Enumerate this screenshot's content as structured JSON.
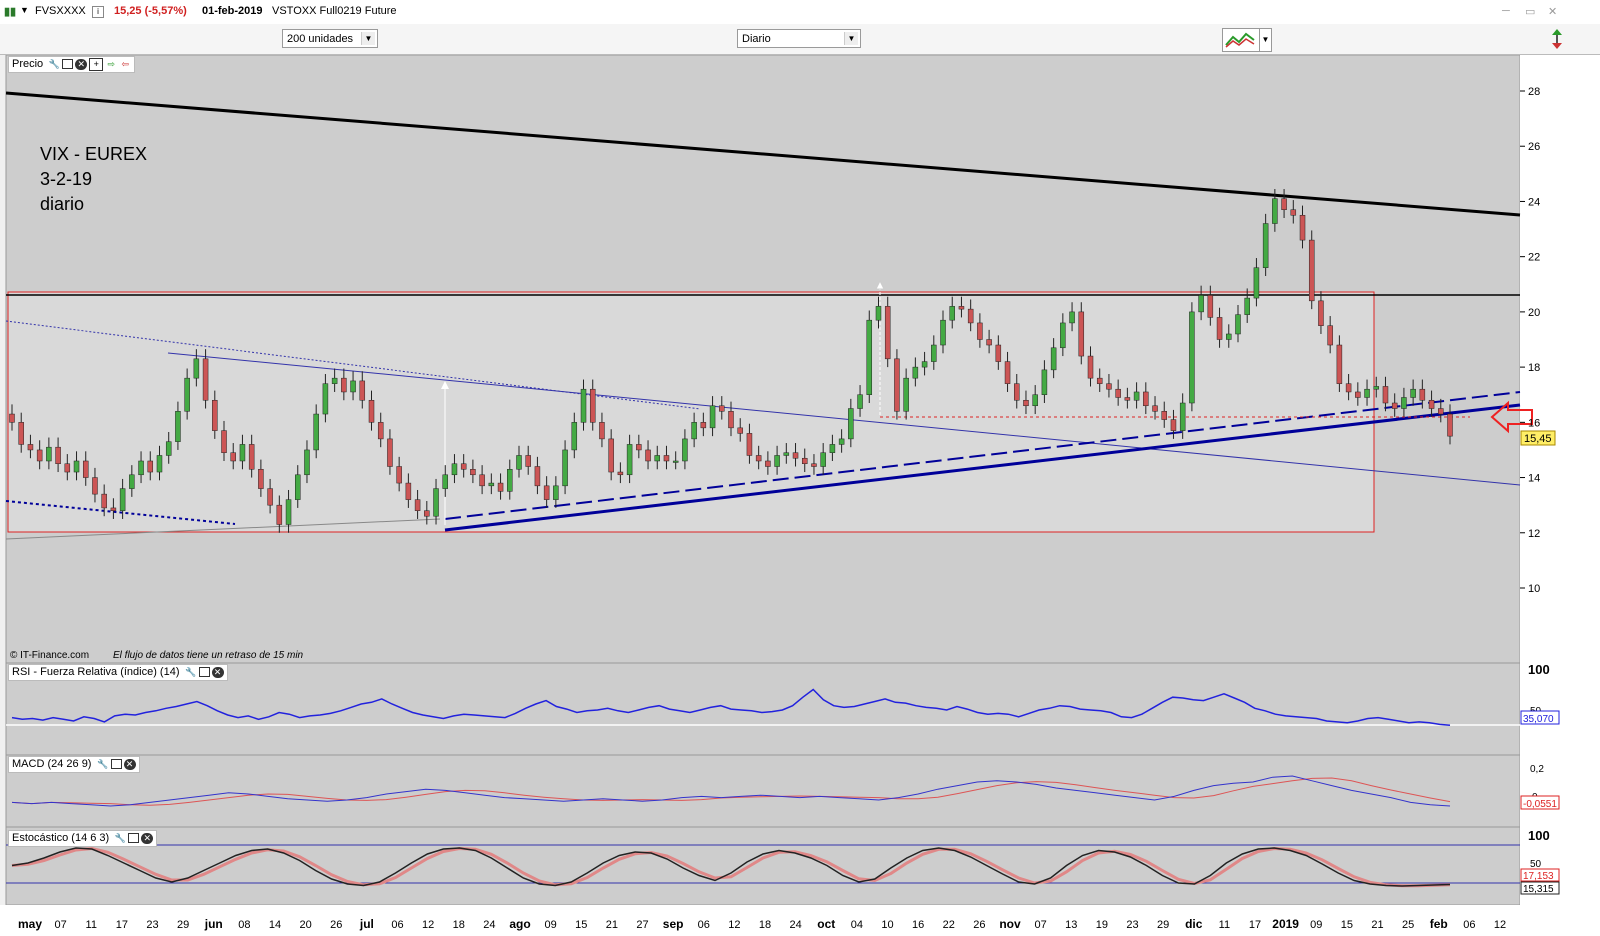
{
  "window": {
    "symbol": "FVSXXXX",
    "change": "15,25 (-5,57%)",
    "date": "01-feb-2019",
    "description": "VSTOXX Full0219 Future"
  },
  "toolbar": {
    "units_select": "200 unidades",
    "period_select": "Diario"
  },
  "price_panel": {
    "title": "Precio",
    "annotation_lines": [
      "VIX - EUREX",
      "3-2-19",
      "diario"
    ],
    "footer_source": "© IT-Finance.com",
    "footer_note": "El flujo de datos tiene un retraso de 15 min",
    "y_ticks": [
      "28",
      "26",
      "24",
      "22",
      "20",
      "18",
      "16",
      "14",
      "12",
      "10"
    ],
    "last_price_label": "15,45"
  },
  "rsi_panel": {
    "title": "RSI - Fuerza Relativa (índice) (14)",
    "y_ticks": [
      "100",
      "50"
    ],
    "value_label": "35,070"
  },
  "macd_panel": {
    "title": "MACD (24 26 9)",
    "y_ticks": [
      "0,2",
      "0"
    ],
    "value_label": "-0,0551"
  },
  "stoch_panel": {
    "title": "Estocástico (14 6 3)",
    "y_ticks": [
      "100",
      "50"
    ],
    "value_label_1": "17,153",
    "value_label_2": "15,315"
  },
  "x_axis": {
    "labels": [
      {
        "t": "may",
        "bold": true
      },
      {
        "t": "07"
      },
      {
        "t": "11"
      },
      {
        "t": "17"
      },
      {
        "t": "23"
      },
      {
        "t": "29"
      },
      {
        "t": "jun",
        "bold": true
      },
      {
        "t": "08"
      },
      {
        "t": "14"
      },
      {
        "t": "20"
      },
      {
        "t": "26"
      },
      {
        "t": "jul",
        "bold": true
      },
      {
        "t": "06"
      },
      {
        "t": "12"
      },
      {
        "t": "18"
      },
      {
        "t": "24"
      },
      {
        "t": "ago",
        "bold": true
      },
      {
        "t": "09"
      },
      {
        "t": "15"
      },
      {
        "t": "21"
      },
      {
        "t": "27"
      },
      {
        "t": "sep",
        "bold": true
      },
      {
        "t": "06"
      },
      {
        "t": "12"
      },
      {
        "t": "18"
      },
      {
        "t": "24"
      },
      {
        "t": "oct",
        "bold": true
      },
      {
        "t": "04"
      },
      {
        "t": "10"
      },
      {
        "t": "16"
      },
      {
        "t": "22"
      },
      {
        "t": "26"
      },
      {
        "t": "nov",
        "bold": true
      },
      {
        "t": "07"
      },
      {
        "t": "13"
      },
      {
        "t": "19"
      },
      {
        "t": "23"
      },
      {
        "t": "29"
      },
      {
        "t": "dic",
        "bold": true
      },
      {
        "t": "11"
      },
      {
        "t": "17"
      },
      {
        "t": "2019",
        "bold": true
      },
      {
        "t": "09"
      },
      {
        "t": "15"
      },
      {
        "t": "21"
      },
      {
        "t": "25"
      },
      {
        "t": "feb",
        "bold": true
      },
      {
        "t": "06"
      },
      {
        "t": "12"
      }
    ]
  },
  "colors": {
    "up_candle": "#44aa44",
    "down_candle": "#cc5555",
    "trend_blue": "#000099",
    "rsi_line": "#2222dd",
    "macd_line": "#3333cc",
    "signal_line": "#dd5555",
    "box_red": "#dd2222"
  },
  "chart_data": {
    "type": "candlestick",
    "price_ylim": [
      9,
      29
    ],
    "closes": [
      16.0,
      15.2,
      15.0,
      14.6,
      15.1,
      14.5,
      14.2,
      14.6,
      14.0,
      13.4,
      12.9,
      12.8,
      13.6,
      14.1,
      14.6,
      14.2,
      14.8,
      15.3,
      16.4,
      17.6,
      18.3,
      16.8,
      15.7,
      14.9,
      14.6,
      15.2,
      14.3,
      13.6,
      13.0,
      12.3,
      13.2,
      14.1,
      15.0,
      16.3,
      17.4,
      17.6,
      17.1,
      17.5,
      16.8,
      16.0,
      15.4,
      14.4,
      13.8,
      13.2,
      12.8,
      12.6,
      13.6,
      14.1,
      14.5,
      14.3,
      14.1,
      13.7,
      13.8,
      13.5,
      14.3,
      14.8,
      14.4,
      13.7,
      13.2,
      13.7,
      15.0,
      16.0,
      17.2,
      16.0,
      15.4,
      14.2,
      14.1,
      15.2,
      15.0,
      14.6,
      14.8,
      14.6,
      14.6,
      15.4,
      16.0,
      15.8,
      16.6,
      16.4,
      15.8,
      15.6,
      14.8,
      14.6,
      14.4,
      14.8,
      14.9,
      14.7,
      14.5,
      14.4,
      14.9,
      15.2,
      15.4,
      16.5,
      17.0,
      19.7,
      20.2,
      18.3,
      16.4,
      17.6,
      18.0,
      18.2,
      18.8,
      19.7,
      20.2,
      20.1,
      19.6,
      19.0,
      18.8,
      18.2,
      17.4,
      16.8,
      16.6,
      17.0,
      17.9,
      18.7,
      19.6,
      20.0,
      18.4,
      17.6,
      17.4,
      17.2,
      16.9,
      16.8,
      17.1,
      16.6,
      16.4,
      16.1,
      15.7,
      16.7,
      20.0,
      20.6,
      19.8,
      19.0,
      19.2,
      19.9,
      20.5,
      21.6,
      23.2,
      24.1,
      23.7,
      23.5,
      22.6,
      20.4,
      19.5,
      18.8,
      17.4,
      17.1,
      16.9,
      17.2,
      17.3,
      16.7,
      16.5,
      16.9,
      17.2,
      16.8,
      16.5,
      16.3,
      15.5
    ],
    "rsi": [
      44,
      42,
      43,
      41,
      44,
      42,
      40,
      45,
      43,
      39,
      46,
      48,
      47,
      50,
      52,
      55,
      57,
      60,
      63,
      58,
      52,
      47,
      44,
      46,
      42,
      45,
      50,
      48,
      44,
      46,
      47,
      49,
      52,
      56,
      60,
      62,
      66,
      60,
      55,
      50,
      47,
      45,
      43,
      46,
      48,
      47,
      46,
      45,
      44,
      49,
      55,
      60,
      64,
      57,
      54,
      50,
      52,
      53,
      55,
      52,
      50,
      53,
      56,
      58,
      54,
      52,
      50,
      53,
      56,
      58,
      54,
      53,
      52,
      50,
      51,
      53,
      58,
      68,
      77,
      65,
      58,
      56,
      57,
      60,
      63,
      66,
      62,
      61,
      58,
      56,
      55,
      53,
      57,
      54,
      50,
      48,
      49,
      48,
      45,
      49,
      53,
      55,
      58,
      57,
      54,
      53,
      52,
      50,
      45,
      44,
      48,
      55,
      62,
      68,
      67,
      65,
      64,
      68,
      72,
      67,
      62,
      55,
      52,
      48,
      46,
      45,
      44,
      43,
      40,
      39,
      38,
      40,
      43,
      44,
      42,
      40,
      38,
      39,
      38,
      36,
      35
    ],
    "macd": [
      -0.02,
      -0.03,
      -0.02,
      -0.03,
      -0.04,
      -0.05,
      -0.04,
      -0.02,
      0.0,
      0.02,
      0.04,
      0.06,
      0.05,
      0.03,
      0.01,
      0.0,
      -0.01,
      0.0,
      0.02,
      0.05,
      0.07,
      0.09,
      0.08,
      0.06,
      0.04,
      0.02,
      0.01,
      0.0,
      -0.01,
      0.0,
      0.01,
      0.0,
      -0.01,
      0.0,
      0.02,
      0.03,
      0.02,
      0.03,
      0.04,
      0.03,
      0.02,
      0.03,
      0.02,
      0.01,
      0.0,
      0.02,
      0.05,
      0.09,
      0.12,
      0.15,
      0.16,
      0.15,
      0.13,
      0.1,
      0.08,
      0.06,
      0.04,
      0.02,
      0.0,
      0.03,
      0.08,
      0.12,
      0.14,
      0.15,
      0.19,
      0.2,
      0.16,
      0.12,
      0.08,
      0.05,
      0.02,
      -0.02,
      -0.04,
      -0.05
    ],
    "stoch": [
      55,
      60,
      70,
      82,
      90,
      88,
      75,
      60,
      45,
      30,
      22,
      30,
      45,
      60,
      75,
      85,
      88,
      80,
      65,
      45,
      28,
      18,
      15,
      22,
      40,
      60,
      78,
      88,
      90,
      85,
      70,
      50,
      30,
      18,
      15,
      22,
      40,
      60,
      75,
      82,
      80,
      68,
      50,
      35,
      25,
      40,
      62,
      78,
      85,
      80,
      70,
      55,
      35,
      22,
      28,
      50,
      70,
      85,
      90,
      85,
      72,
      55,
      38,
      22,
      18,
      30,
      55,
      75,
      85,
      82,
      72,
      55,
      35,
      20,
      18,
      35,
      60,
      78,
      88,
      90,
      85,
      75,
      58,
      40,
      25,
      18,
      15,
      14,
      15,
      16,
      17
    ]
  }
}
